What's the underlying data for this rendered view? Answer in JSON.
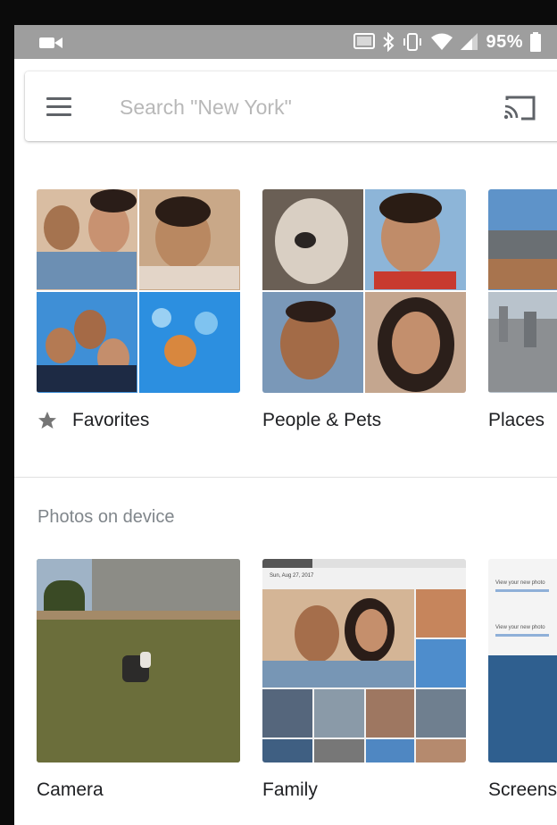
{
  "status_bar": {
    "battery_percent": "95%"
  },
  "search": {
    "placeholder": "Search \"New York\""
  },
  "albums_row": [
    {
      "label": "Favorites",
      "icon": "star-icon"
    },
    {
      "label": "People & Pets"
    },
    {
      "label": "Places"
    }
  ],
  "device_section": {
    "title": "Photos on device",
    "folders": [
      {
        "label": "Camera"
      },
      {
        "label": "Family"
      },
      {
        "label": "Screens"
      }
    ]
  },
  "family_thumb": {
    "date_text": "Sun, Aug 27, 2017"
  },
  "screenshot_thumb": {
    "lines": [
      "View your new photo",
      "View your new photo"
    ]
  },
  "colors": {
    "status_bar": "#9e9e9e",
    "text_primary": "#202124",
    "text_secondary": "#80868b",
    "sky_blue": "#3f8fd6"
  }
}
